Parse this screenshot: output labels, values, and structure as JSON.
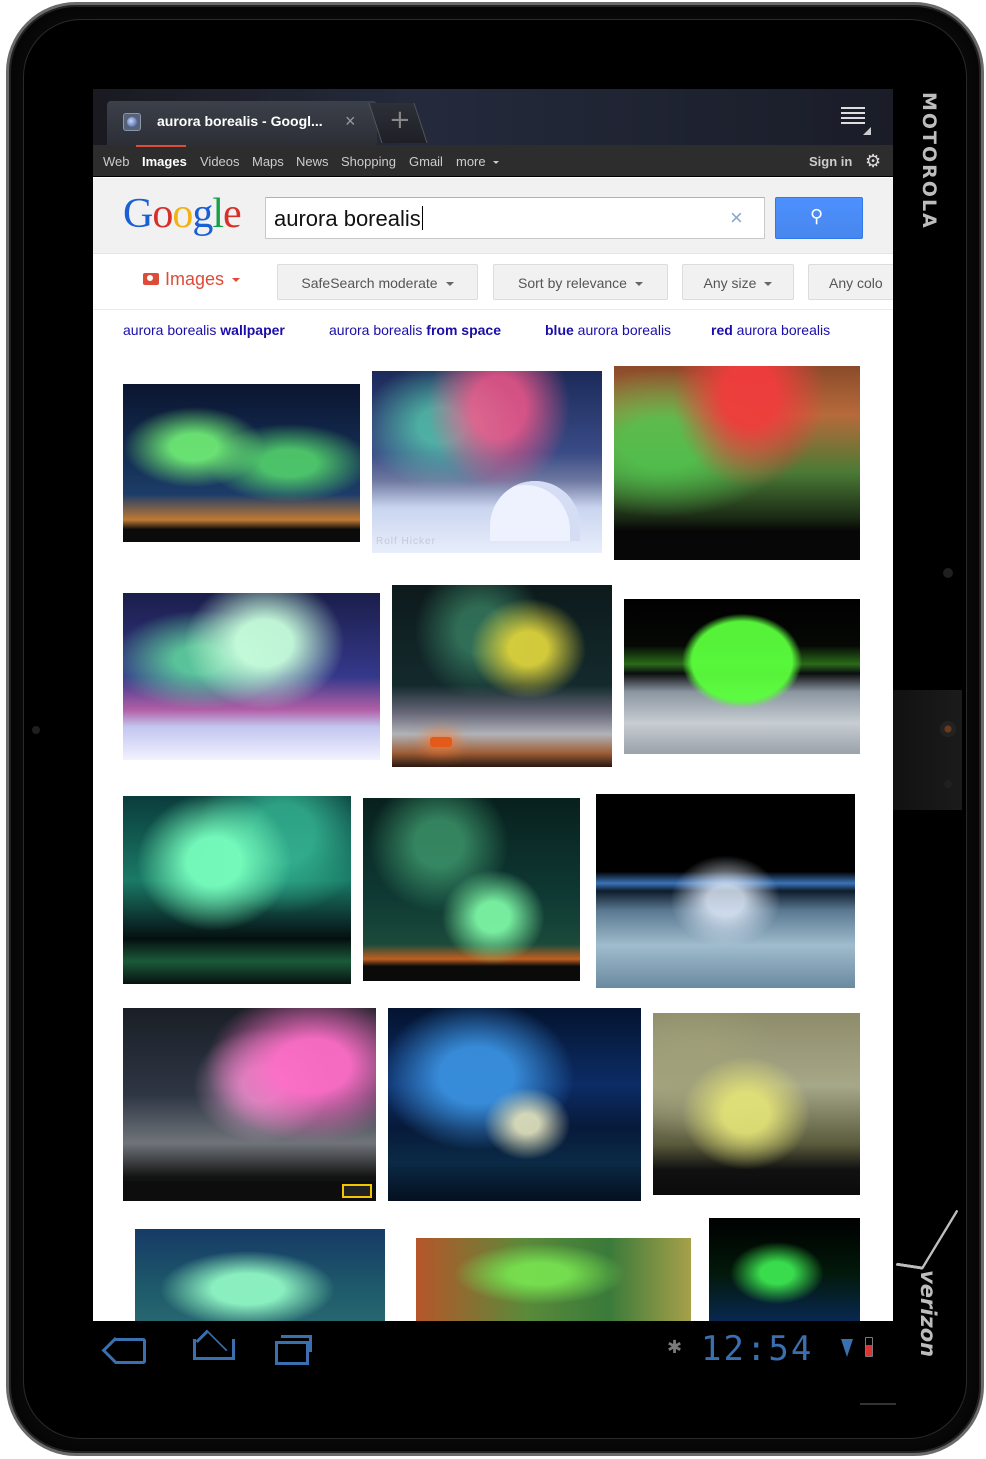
{
  "device": {
    "brand": "MOTOROLA",
    "carrier": "verizon"
  },
  "browser": {
    "tab_title": "aurora borealis - Googl...",
    "tab_close": "×",
    "new_tab": "+"
  },
  "gbar": {
    "items": [
      "Web",
      "Images",
      "Videos",
      "Maps",
      "News",
      "Shopping",
      "Gmail",
      "more"
    ],
    "active": "Images",
    "signin": "Sign in"
  },
  "search": {
    "logo": "Google",
    "query": "aurora borealis",
    "clear": "×"
  },
  "tools": {
    "images": "Images",
    "safesearch": "SafeSearch moderate",
    "sort": "Sort by relevance",
    "size": "Any size",
    "color": "Any colo"
  },
  "related": [
    {
      "plain": "aurora borealis ",
      "bold": "wallpaper",
      "bold_first": false
    },
    {
      "plain": "aurora borealis ",
      "bold": "from space",
      "bold_first": false
    },
    {
      "plain": " aurora borealis",
      "bold": "blue",
      "bold_first": true
    },
    {
      "plain": " aurora borealis",
      "bold": "red",
      "bold_first": true
    }
  ],
  "images": {
    "credit": "Rolf Hicker"
  },
  "status": {
    "clock": "12:54"
  },
  "colors": {
    "accent_blue": "#4d90fe",
    "link": "#1a0dab",
    "images_red": "#dd4b39",
    "system_blue": "#3a6fb0"
  }
}
